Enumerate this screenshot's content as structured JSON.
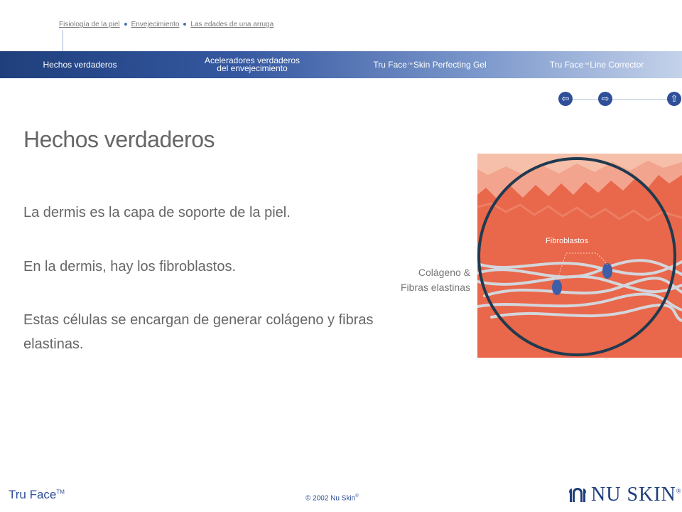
{
  "breadcrumb": {
    "items": [
      "Fisiología de la piel",
      "Envejecimiento",
      "Las edades de una arruga"
    ]
  },
  "nav": {
    "item1": "Hechos verdaderos",
    "item2_line1": "Aceleradores verdaderos",
    "item2_line2": "del envejecimiento",
    "item3_pre": "Tru Face",
    "item3_tm": "™",
    "item3_post": "Skin Perfecting Gel",
    "item4_pre": "Tru Face",
    "item4_tm": "™",
    "item4_post": "Line Corrector"
  },
  "controls": {
    "back_icon": "arrow-left-icon",
    "forward_icon": "arrow-right-icon",
    "up_icon": "arrow-up-icon"
  },
  "main": {
    "title": "Hechos verdaderos",
    "p1": "La dermis es la capa de soporte de la piel.",
    "p2": "En la dermis, hay los fibroblastos.",
    "p3_line1": "Estas células se encargan de generar colágeno y fibras",
    "p3_line2": "elastinas."
  },
  "illustration": {
    "fibroblast_label": "Fibroblastos",
    "side_label_line1": "Colágeno &",
    "side_label_line2": "Fibras elastinas",
    "colors": {
      "skin_light": "#f2a48e",
      "skin_dark": "#e9674a",
      "circle": "#1f3a4f",
      "fiber": "#d3d6dc",
      "cell": "#3f5ea8"
    }
  },
  "footer": {
    "brand": "Tru Face",
    "brand_tm": "TM",
    "copyright": "© 2002 Nu Skin",
    "copyright_reg": "®",
    "logo_text": "NU SKIN",
    "logo_reg": "®"
  }
}
